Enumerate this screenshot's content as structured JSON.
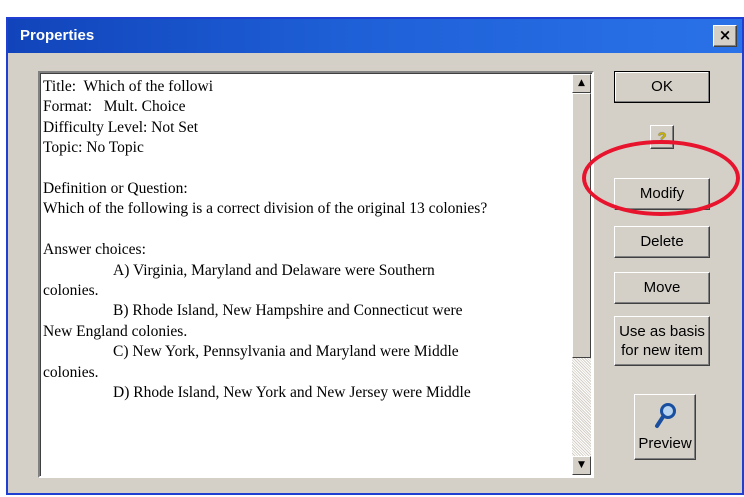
{
  "window": {
    "title": "Properties",
    "close_symbol": "×"
  },
  "details": {
    "title_line": "Title:  Which of the followi",
    "format_line": "Format:   Mult. Choice",
    "difficulty_line": "Difficulty Level: Not Set",
    "topic_line": "Topic: No Topic",
    "question_heading": "Definition or Question:",
    "question_text": "Which of the following is a correct division of the original 13 colonies?",
    "answers_heading": "Answer choices:",
    "choices": [
      {
        "first": "A) Virginia, Maryland and Delaware were Southern",
        "rest": "colonies."
      },
      {
        "first": "B) Rhode Island, New Hampshire and Connecticut were",
        "rest": "New England colonies."
      },
      {
        "first": "C) New York, Pennsylvania and Maryland were Middle",
        "rest": "colonies."
      },
      {
        "first": "D) Rhode Island, New York and New Jersey were Middle",
        "rest": ""
      }
    ]
  },
  "buttons": {
    "ok": "OK",
    "help": "?",
    "modify": "Modify",
    "delete": "Delete",
    "move": "Move",
    "basis": "Use as basis\nfor new item",
    "preview": "Preview"
  },
  "icons": {
    "scroll_up": "▲",
    "scroll_down": "▼",
    "preview_icon": "magnifier-icon"
  },
  "colors": {
    "title_bar": "#1e5fd6",
    "highlight": "#e8142e"
  }
}
